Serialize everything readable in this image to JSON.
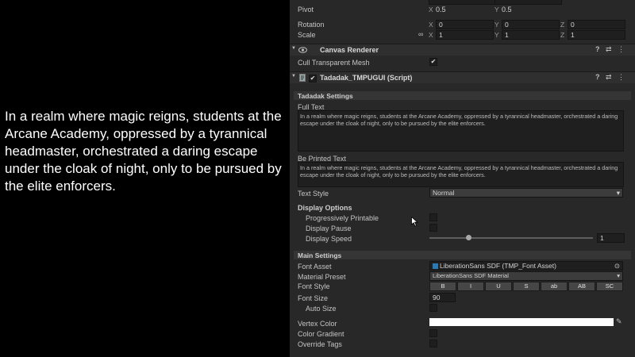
{
  "game_text": "In a realm where magic reigns, students at the Arcane Academy, oppressed by a tyrannical headmaster, orchestrated a daring escape under the cloak of night, only to be pursued by the elite enforcers.",
  "transform": {
    "pivot_label": "Pivot",
    "pivot_x": "0.5",
    "pivot_y": "0.5",
    "rotation_label": "Rotation",
    "rot_x": "0",
    "rot_y": "0",
    "rot_z": "0",
    "scale_label": "Scale",
    "scale_x": "1",
    "scale_y": "1",
    "scale_z": "1",
    "axis_x": "X",
    "axis_y": "Y",
    "axis_z": "Z"
  },
  "canvas_renderer": {
    "title": "Canvas Renderer",
    "cull_label": "Cull Transparent Mesh",
    "cull_checked": "✔"
  },
  "script": {
    "title": "Tadadak_TMPUGUI (Script)",
    "enabled_check": "✔",
    "section_title": "Tadadak Settings",
    "full_text_label": "Full Text",
    "full_text": "In a realm where magic reigns, students at the Arcane Academy, oppressed by a tyrannical headmaster, orchestrated a daring escape under the cloak of night, only to be pursued by the elite enforcers.",
    "printed_label": "Be Printed Text",
    "printed_text": "In a realm where magic reigns, students at the Arcane Academy, oppressed by a tyrannical headmaster, orchestrated a daring escape under the cloak of night, only to be pursued by the elite enforcers.",
    "text_style_label": "Text Style",
    "text_style_value": "Normal",
    "display_options_label": "Display Options",
    "prog_label": "Progressively Printable",
    "pause_label": "Display Pause",
    "speed_label": "Display Speed",
    "speed_value": "1",
    "speed_fraction": 0.24
  },
  "main_settings": {
    "section_title": "Main Settings",
    "font_asset_label": "Font Asset",
    "font_asset_value": "LiberationSans SDF (TMP_Font Asset)",
    "material_label": "Material Preset",
    "material_value": "LiberationSans SDF Material",
    "font_style_label": "Font Style",
    "style_buttons": [
      "B",
      "I",
      "U",
      "S",
      "ab",
      "AB",
      "SC"
    ],
    "font_size_label": "Font Size",
    "font_size_value": "90",
    "auto_size_label": "Auto Size",
    "vertex_color_label": "Vertex Color",
    "vertex_color": "#ffffff",
    "gradient_label": "Color Gradient",
    "override_label": "Override Tags"
  },
  "icons": {
    "help": "?",
    "preset": "⇄",
    "menu": "⋮",
    "dropdown": "▾",
    "picker": "⊙",
    "eyedropper": "✎",
    "link": "∞",
    "foldout": "▼"
  }
}
